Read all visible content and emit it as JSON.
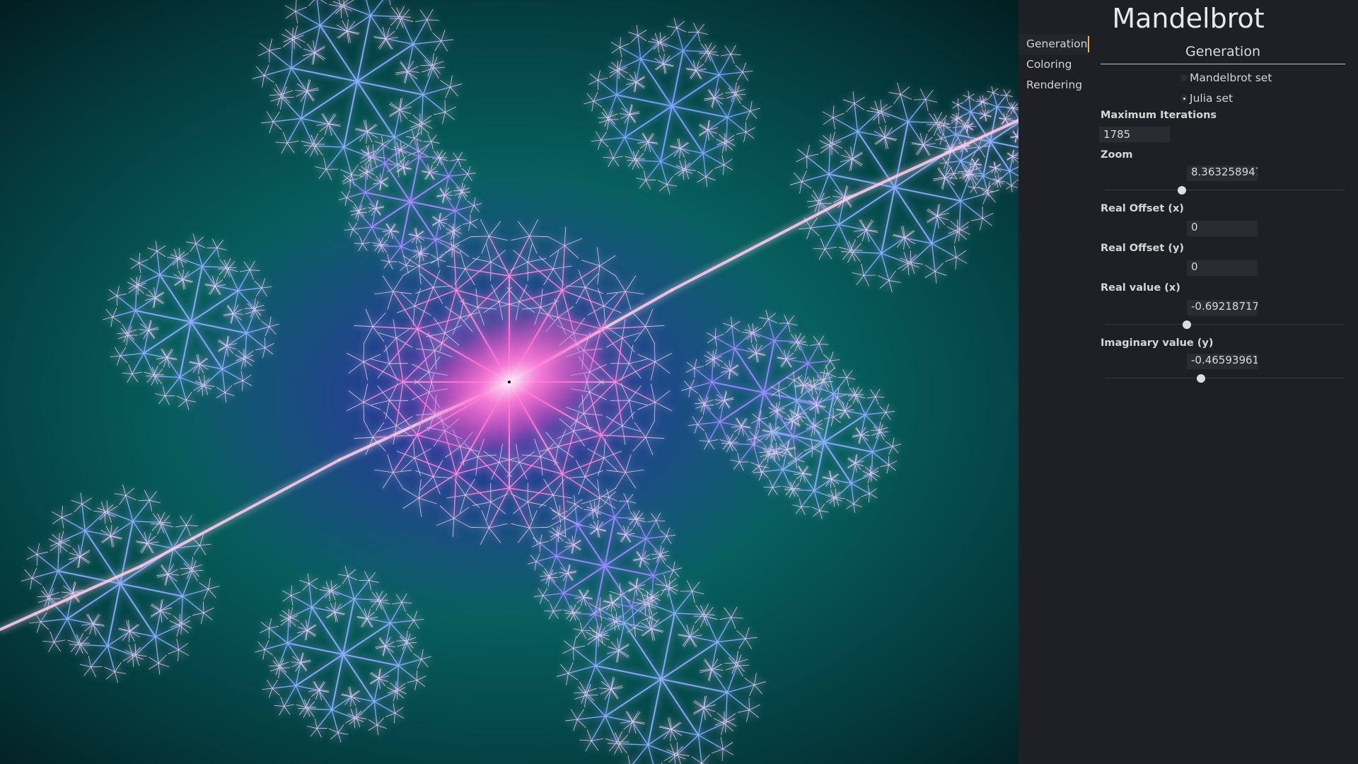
{
  "app": {
    "title": "Mandelbrot"
  },
  "nav": {
    "items": [
      {
        "label": "Generation",
        "active": true
      },
      {
        "label": "Coloring",
        "active": false
      },
      {
        "label": "Rendering",
        "active": false
      }
    ]
  },
  "generation": {
    "section_title": "Generation",
    "set_options": [
      {
        "label": "Mandelbrot set",
        "checked": false
      },
      {
        "label": "Julia set",
        "checked": true
      }
    ],
    "max_iterations": {
      "label": "Maximum Iterations",
      "value": "1785"
    },
    "zoom": {
      "label": "Zoom",
      "value": "8.363258947",
      "slider_fraction": 0.32
    },
    "real_offset_x": {
      "label": "Real Offset (x)",
      "value": "0"
    },
    "real_offset_y": {
      "label": "Real Offset (y)",
      "value": "0"
    },
    "real_value_x": {
      "label": "Real value (x)",
      "value": "-0.692187175",
      "slider_fraction": 0.34
    },
    "imag_value_y": {
      "label": "Imaginary value (y)",
      "value": "-0.465939610",
      "slider_fraction": 0.4
    }
  },
  "colors": {
    "accent": "#e7b95d",
    "panel_bg": "#1e2026",
    "fractal_glow": "#3aa0ff",
    "fractal_core": "#ff5fd0",
    "background_teal": "#0a7f80"
  }
}
